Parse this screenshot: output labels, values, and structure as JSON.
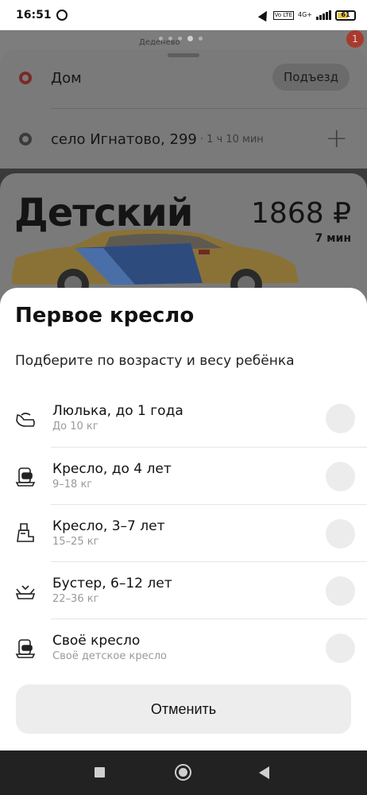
{
  "status_bar": {
    "time": "16:51",
    "network": "4G+",
    "volte": "Vo LTE",
    "battery": "61"
  },
  "map": {
    "place_label": "Деденево",
    "notification_count": "1"
  },
  "route": {
    "origin": "Дом",
    "entrance_button": "Подъезд",
    "destination": "село Игнатово, 299",
    "eta": "· 1 ч 10 мин",
    "add_button": "+"
  },
  "tariff": {
    "name": "Детский",
    "price": "1868 ₽",
    "pickup_time": "7 мин"
  },
  "sheet": {
    "title": "Первое кресло",
    "subtitle": "Подберите по возрасту и весу ребёнка",
    "options": [
      {
        "label": "Люлька, до 1 года",
        "sub": "До 10 кг",
        "icon": "carrycot-icon"
      },
      {
        "label": "Кресло, до 4 лет",
        "sub": "9–18 кг",
        "icon": "child-seat-icon"
      },
      {
        "label": "Кресло, 3–7 лет",
        "sub": "15–25 кг",
        "icon": "child-seat-highback-icon"
      },
      {
        "label": "Бустер, 6–12 лет",
        "sub": "22–36 кг",
        "icon": "booster-icon"
      },
      {
        "label": "Своё кресло",
        "sub": "Своё детское кресло",
        "icon": "own-seat-icon"
      }
    ],
    "cancel_label": "Отменить"
  },
  "colors": {
    "car_yellow": "#e0b43a",
    "accent_red": "#7a2a26",
    "sheet_bg": "#ffffff",
    "dim_overlay": "#7a7a7a"
  }
}
